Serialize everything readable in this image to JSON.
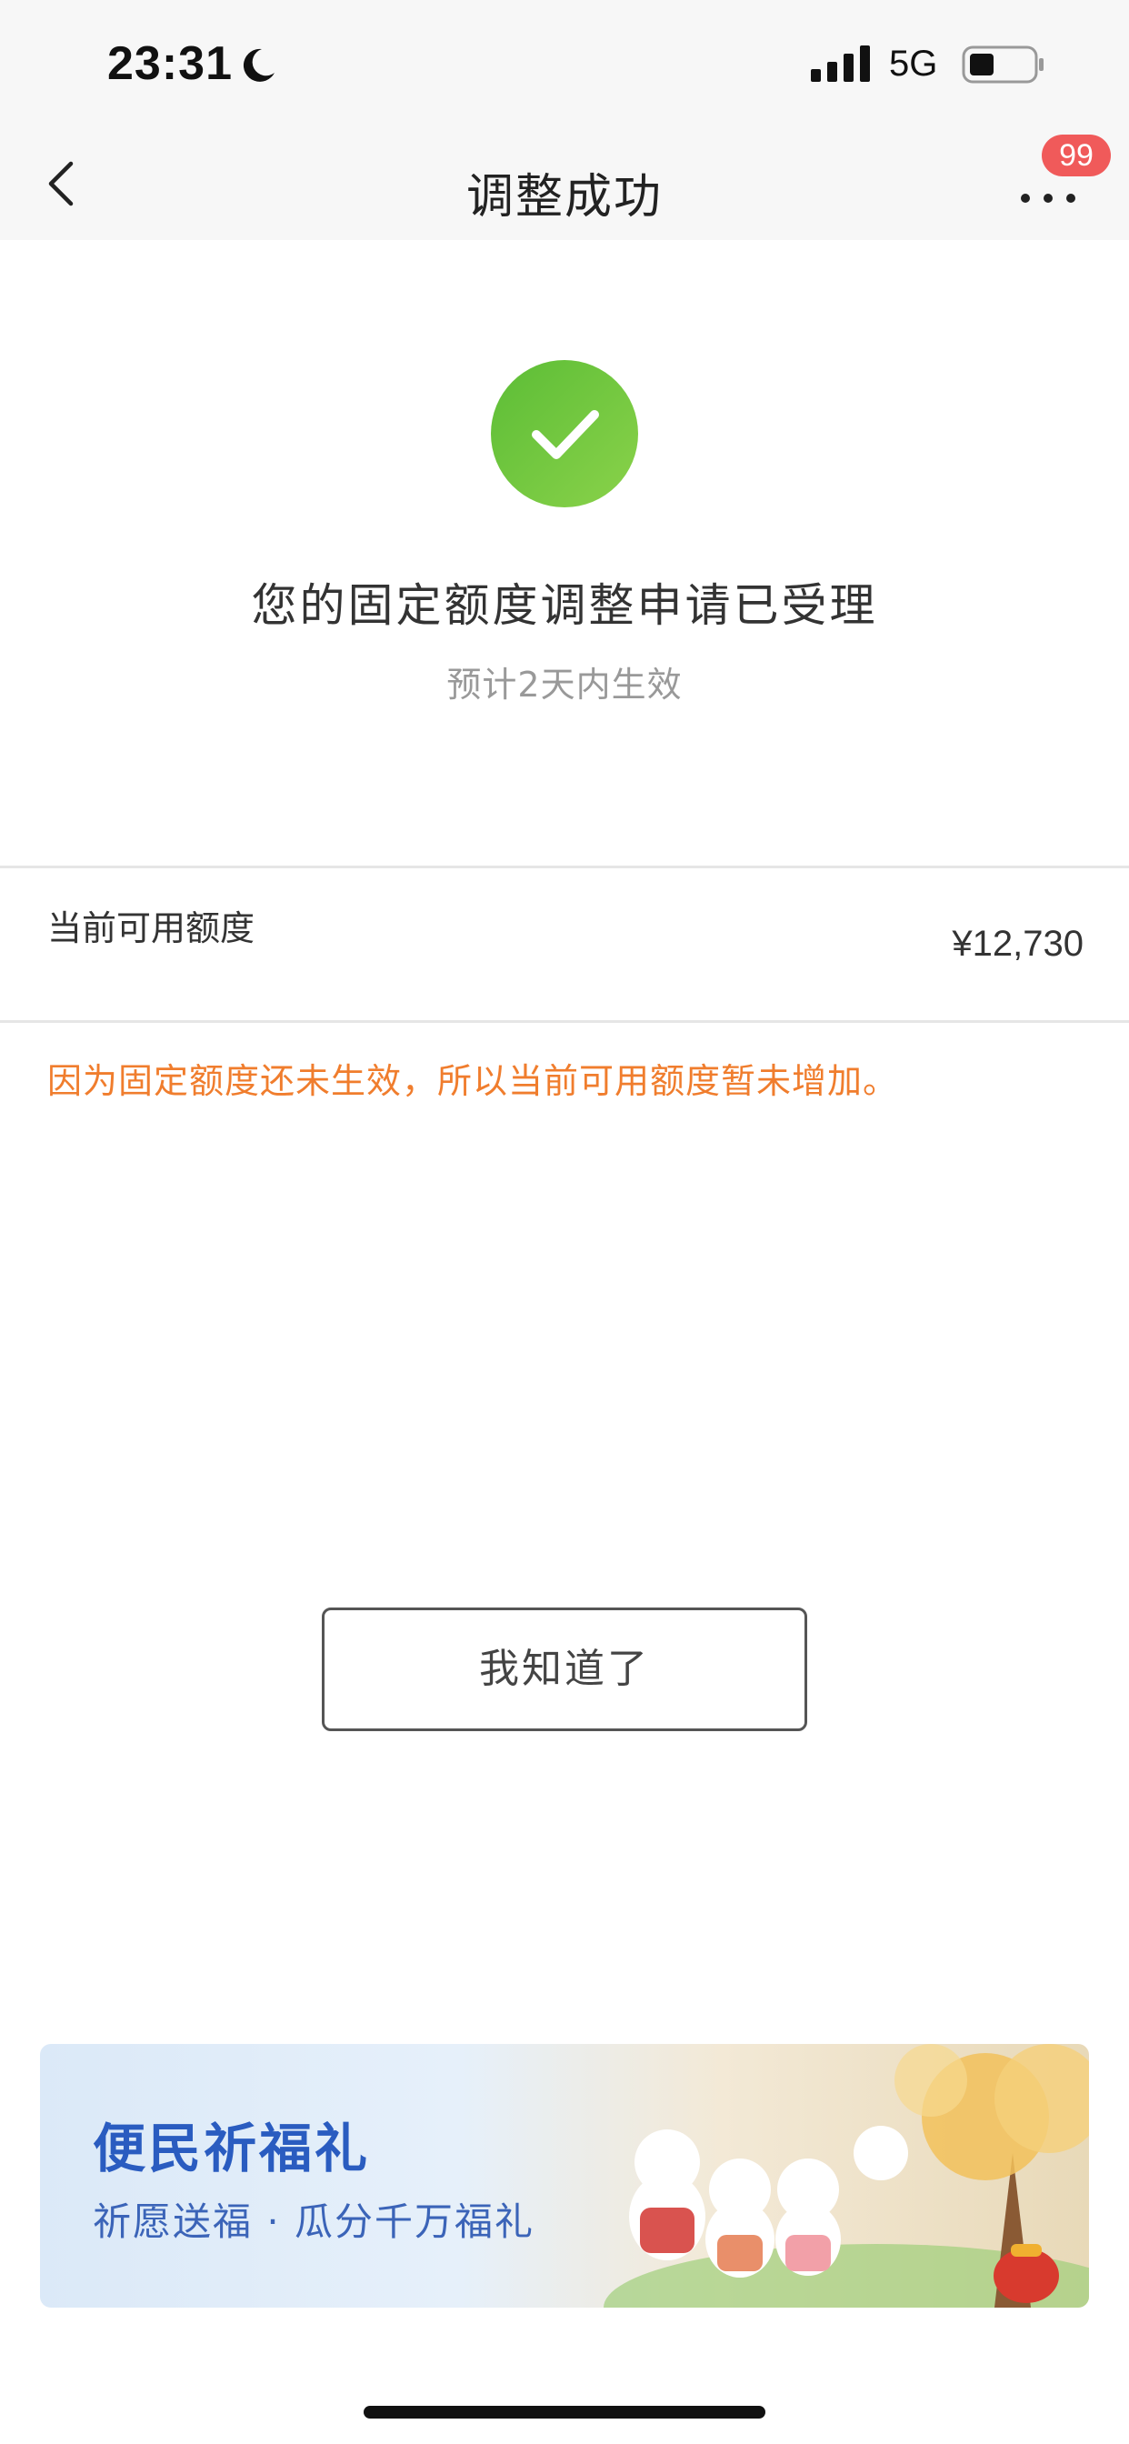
{
  "status_bar": {
    "time": "23:31",
    "network": "5G",
    "icons": [
      "moon-icon",
      "signal-icon",
      "battery-icon"
    ]
  },
  "nav": {
    "title": "调整成功",
    "back_icon": "chevron-left-icon",
    "more_icon": "more-dots-icon",
    "badge_count": "99"
  },
  "result": {
    "icon": "check-circle-icon",
    "title": "您的固定额度调整申请已受理",
    "subtitle": "预计2天内生效"
  },
  "credit": {
    "label": "当前可用额度",
    "value": "¥12,730"
  },
  "notice": "因为固定额度还未生效，所以当前可用额度暂未增加。",
  "confirm_button": "我知道了",
  "banner": {
    "title": "便民祈福礼",
    "subtitle": "祈愿送福 · 瓜分千万福礼"
  },
  "colors": {
    "success_green": "#6cc63a",
    "notice_orange": "#f07d2d",
    "badge_red": "#f05a5a",
    "banner_blue": "#2a5cc0"
  }
}
